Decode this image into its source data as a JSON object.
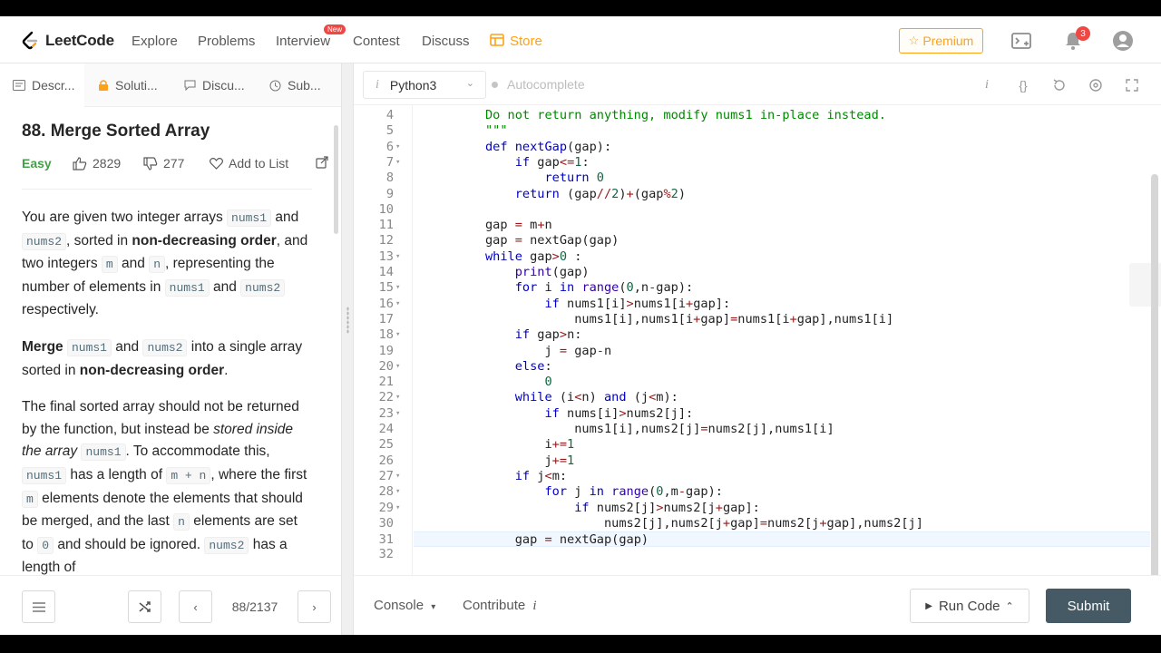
{
  "nav": {
    "logo": "LeetCode",
    "items": [
      "Explore",
      "Problems",
      "Interview",
      "Contest",
      "Discuss",
      "Store"
    ],
    "new_badge": "New",
    "premium": "Premium",
    "notifications": "3"
  },
  "tabs": [
    "Descr...",
    "Soluti...",
    "Discu...",
    "Sub..."
  ],
  "problem": {
    "title": "88. Merge Sorted Array",
    "difficulty": "Easy",
    "likes": "2829",
    "dislikes": "277",
    "add_to_list": "Add to List"
  },
  "description": {
    "p1": [
      "You are given two integer arrays ",
      "nums1",
      " and ",
      "nums2",
      ", sorted in ",
      "non-decreasing order",
      ", and two integers ",
      "m",
      " and ",
      "n",
      ", representing the number of elements in ",
      "nums1",
      " and ",
      "nums2",
      " respectively."
    ],
    "p2": [
      "Merge",
      " ",
      "nums1",
      " and ",
      "nums2",
      " into a single array sorted in ",
      "non-decreasing order",
      "."
    ],
    "p3": [
      "The final sorted array should not be returned by the function, but instead be ",
      "stored inside the array",
      " ",
      "nums1",
      ". To accommodate this, ",
      "nums1",
      " has a length of ",
      "m + n",
      ", where the first ",
      "m",
      " elements denote the elements that should be merged, and the last ",
      "n",
      " elements are set to ",
      "0",
      " and should be ignored. ",
      "nums2",
      " has a length of"
    ]
  },
  "pager": {
    "text": "88/2137"
  },
  "editor": {
    "language": "Python3",
    "autocomplete": "Autocomplete",
    "lines": [
      {
        "n": "4",
        "fold": false,
        "code": "Do not return anything, modify nums1 in-place instead."
      },
      {
        "n": "5",
        "fold": false,
        "code": "\"\"\""
      },
      {
        "n": "6",
        "fold": true,
        "code": "def nextGap(gap):"
      },
      {
        "n": "7",
        "fold": true,
        "code": "    if gap<=1:"
      },
      {
        "n": "8",
        "fold": false,
        "code": "        return 0"
      },
      {
        "n": "9",
        "fold": false,
        "code": "    return (gap//2)+(gap%2)"
      },
      {
        "n": "10",
        "fold": false,
        "code": ""
      },
      {
        "n": "11",
        "fold": false,
        "code": "gap = m+n"
      },
      {
        "n": "12",
        "fold": false,
        "code": "gap = nextGap(gap)"
      },
      {
        "n": "13",
        "fold": true,
        "code": "while gap>0 :"
      },
      {
        "n": "14",
        "fold": false,
        "code": "    print(gap)"
      },
      {
        "n": "15",
        "fold": true,
        "code": "    for i in range(0,n-gap):"
      },
      {
        "n": "16",
        "fold": true,
        "code": "        if nums1[i]>nums1[i+gap]:"
      },
      {
        "n": "17",
        "fold": false,
        "code": "            nums1[i],nums1[i+gap]=nums1[i+gap],nums1[i]"
      },
      {
        "n": "18",
        "fold": true,
        "code": "    if gap>n:"
      },
      {
        "n": "19",
        "fold": false,
        "code": "        j = gap-n"
      },
      {
        "n": "20",
        "fold": true,
        "code": "    else:"
      },
      {
        "n": "21",
        "fold": false,
        "code": "        0"
      },
      {
        "n": "22",
        "fold": true,
        "code": "    while (i<n) and (j<m):"
      },
      {
        "n": "23",
        "fold": true,
        "code": "        if nums[i]>nums2[j]:"
      },
      {
        "n": "24",
        "fold": false,
        "code": "            nums1[i],nums2[j]=nums2[j],nums1[i]"
      },
      {
        "n": "25",
        "fold": false,
        "code": "        i+=1"
      },
      {
        "n": "26",
        "fold": false,
        "code": "        j+=1"
      },
      {
        "n": "27",
        "fold": true,
        "code": "    if j<m:"
      },
      {
        "n": "28",
        "fold": true,
        "code": "        for j in range(0,m-gap):"
      },
      {
        "n": "29",
        "fold": true,
        "code": "            if nums2[j]>nums2[j+gap]:"
      },
      {
        "n": "30",
        "fold": false,
        "code": "                nums2[j],nums2[j+gap]=nums2[j+gap],nums2[j]"
      },
      {
        "n": "31",
        "fold": false,
        "code": "    gap = nextGap(gap)",
        "highlight": true
      },
      {
        "n": "32",
        "fold": false,
        "code": ""
      }
    ]
  },
  "bottom": {
    "console": "Console",
    "contribute": "Contribute",
    "run_code": "Run Code",
    "submit": "Submit"
  },
  "colors": {
    "accent": "#ffa116",
    "easy": "#43a047",
    "submit": "#455a64",
    "keyword": "#0000cc"
  }
}
